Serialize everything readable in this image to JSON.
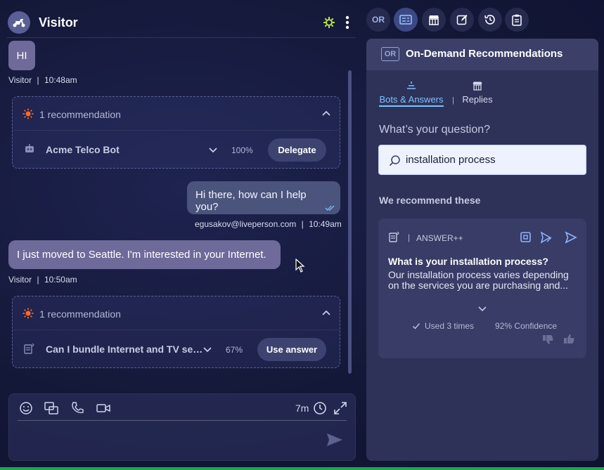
{
  "chat": {
    "header": {
      "title": "Visitor"
    },
    "messages": [
      {
        "text": "HI",
        "meta_sender": "Visitor",
        "meta_time": "10:48am"
      },
      {
        "text": "Hi there, how can I help you?",
        "meta_sender": "egusakov@liveperson.com",
        "meta_time": "10:49am"
      },
      {
        "text": "I just moved to Seattle. I'm interested in your Internet.",
        "meta_sender": "Visitor",
        "meta_time": "10:50am"
      }
    ],
    "meta_separator": "|",
    "recommendations": [
      {
        "count_label": "1 recommendation",
        "item": "Acme Telco Bot",
        "confidence": "100%",
        "action": "Delegate"
      },
      {
        "count_label": "1 recommendation",
        "item": "Can I bundle Internet and TV services?",
        "confidence": "67%",
        "action": "Use answer"
      }
    ],
    "composer": {
      "timer": "7m"
    }
  },
  "toolbar": {
    "or_label": "OR"
  },
  "panel": {
    "badge": "OR",
    "title": "On-Demand Recommendations",
    "tabs": [
      {
        "label": "Bots & Answers",
        "active": true
      },
      {
        "label": "Replies",
        "active": false
      }
    ],
    "tab_separator": "|",
    "question_label": "What’s your question?",
    "search_value": "installation process",
    "recommend_heading": "We recommend these",
    "answer": {
      "type_separator": "|",
      "type": "ANSWER++",
      "title": "What is your installation process?",
      "body": "Our installation process varies depending on the services you are purchasing and...",
      "used": "Used 3 times",
      "confidence": "92% Confidence"
    }
  },
  "colors": {
    "background": "#141838",
    "visitor_bubble": "#6e6a9a",
    "agent_bubble": "#4b547c",
    "accent": "#7cc1ff",
    "sun_icon": "#ff6a2a",
    "gear_icon": "#b8e34a",
    "status_bar": "#1aa84a"
  }
}
